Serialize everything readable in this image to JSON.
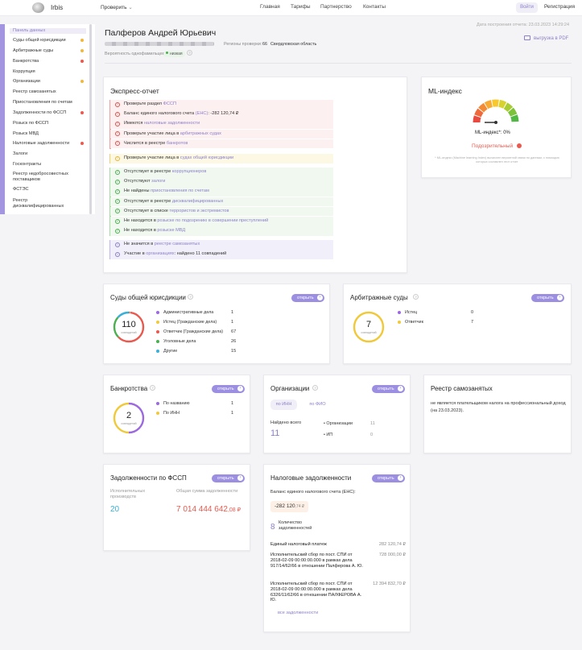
{
  "header": {
    "logo_text": "Irbis",
    "check_label": "Проверить",
    "nav": [
      "Главная",
      "Тарифы",
      "Партнерство",
      "Контакты"
    ],
    "login": "Войти",
    "register": "Регистрация"
  },
  "sidebar": {
    "items": [
      {
        "label": "Панель данных",
        "dot": ""
      },
      {
        "label": "Суды общей юрисдикции",
        "dot": "#f0b73a"
      },
      {
        "label": "Арбитражные суды",
        "dot": "#f0b73a"
      },
      {
        "label": "Банкротства",
        "dot": "#e85a4f"
      },
      {
        "label": "Коррупция",
        "dot": ""
      },
      {
        "label": "Организации",
        "dot": "#f0b73a"
      },
      {
        "label": "Реестр самозанятых",
        "dot": ""
      },
      {
        "label": "Приостановления по счетам",
        "dot": ""
      },
      {
        "label": "Задолженности по ФССП",
        "dot": "#e85a4f"
      },
      {
        "label": "Розыск по ФССП",
        "dot": ""
      },
      {
        "label": "Розыск МВД",
        "dot": ""
      },
      {
        "label": "Налоговые задолженности",
        "dot": "#e85a4f"
      },
      {
        "label": "Залоги",
        "dot": ""
      },
      {
        "label": "Госконтракты",
        "dot": ""
      },
      {
        "label": "Реестр недобросовестных поставщиков",
        "dot": ""
      },
      {
        "label": "ФСТЭС",
        "dot": ""
      },
      {
        "label": "Реестр дисквалифицированных",
        "dot": ""
      }
    ]
  },
  "person": {
    "name": "Палферов Андрей Юрьевич",
    "date": "Дата построения отчета: 23.03.2023 14:29:24",
    "pdf": "выгрузка в PDF",
    "regions_label": "Регионы проверки:",
    "region_code": "66",
    "region_name": "Свердловская область",
    "prob_label": "Вероятность однофамильцев:",
    "prob_value": "низкая"
  },
  "express": {
    "title": "Экспресс-отчет",
    "groups": [
      {
        "type": "red",
        "rows": [
          [
            "Проверьте раздел ",
            "ФССП",
            ""
          ],
          [
            "Баланс единого налогового счета ",
            "(ЕНС)",
            ": -282 120,74 ₽"
          ],
          [
            "Имеются ",
            "налоговые задолженности",
            ""
          ],
          [
            "Проверьте участие лица в ",
            "арбитражных судах",
            ""
          ],
          [
            "Числится в реестре ",
            "банкротов",
            ""
          ]
        ]
      },
      {
        "type": "yel",
        "rows": [
          [
            "Проверьте участие лица в ",
            "судах общей юрисдикции",
            ""
          ]
        ]
      },
      {
        "type": "grn",
        "rows": [
          [
            "Отсутствует в реестре ",
            "коррупционеров",
            ""
          ],
          [
            "Отсутствуют ",
            "залоги",
            ""
          ],
          [
            "Не найдены ",
            "приостановления по счетам",
            ""
          ],
          [
            "Отсутствует в реестре ",
            "дисквалифицированных",
            ""
          ],
          [
            "Отсутствует в списке ",
            "террористов и экстремистов",
            ""
          ],
          [
            "Не находится в ",
            "розыске по подозрению в совершении преступлений",
            ""
          ],
          [
            "Не находится в ",
            "розыске МВД",
            ""
          ]
        ]
      },
      {
        "type": "pur",
        "rows": [
          [
            "Не значится в ",
            "реестре самозанятых",
            ""
          ],
          [
            "Участие в ",
            "организациях",
            ": найдено 11 совпадений"
          ]
        ]
      }
    ]
  },
  "ml": {
    "title": "ML-индекс",
    "value_label": "ML-индекс*: 0%",
    "status": "Подозрительный",
    "note": "* ML-индекс (Machine learning Index) вычислен вероятной связи по данным, с помощью которых составлен этот отчет"
  },
  "courts": {
    "title": "Суды общей юрисдикции",
    "open": "открыть",
    "total": "110",
    "sub": "совпадений",
    "legend": [
      [
        "Административные дела",
        "1",
        "#9c6ade"
      ],
      [
        "Истец (Гражданские дела)",
        "1",
        "#f0c93a"
      ],
      [
        "Ответчик (Гражданские дела)",
        "67",
        "#e85a4f"
      ],
      [
        "Уголовные дела",
        "26",
        "#4caf50"
      ],
      [
        "Другие",
        "15",
        "#3ab0d6"
      ]
    ]
  },
  "arb": {
    "title": "Арбитражные суды",
    "open": "открыть",
    "total": "7",
    "sub": "совпадений",
    "legend": [
      [
        "Истец",
        "0",
        "#9c6ade"
      ],
      [
        "Ответчик",
        "7",
        "#f0c93a"
      ]
    ]
  },
  "bank": {
    "title": "Банкротства",
    "open": "открыть",
    "total": "2",
    "sub": "совпадений",
    "legend": [
      [
        "По названию",
        "1",
        "#9c6ade"
      ],
      [
        "По ИНН",
        "1",
        "#f0c93a"
      ]
    ]
  },
  "orgs": {
    "title": "Организации",
    "open": "открыть",
    "tab1": "по ИНН",
    "tab2": "по ФИО",
    "found_label": "Найдено всего",
    "found": "11",
    "items": [
      [
        "Организации",
        "11"
      ],
      [
        "ИП",
        "0"
      ]
    ]
  },
  "selfemp": {
    "title": "Реестр самозанятых",
    "text": "не является плательщиком налога на профессиональный доход (на 23.03.2023)."
  },
  "fssp": {
    "title": "Задолженности по ФССП",
    "open": "открыть",
    "l1": "Исполнительных производств",
    "v1": "20",
    "l2": "Общая сумма задолженности",
    "v2": "7 014 444 642",
    "v2c": ",08 ₽"
  },
  "tax": {
    "title": "Налоговые задолженности",
    "open": "открыть",
    "bal_label": "Баланс единого налогового счета (ЕНС):",
    "bal": "-282 120",
    "bal_c": ",74 ₽",
    "count": "8",
    "count_label": "Количество задолженностей",
    "rows": [
      [
        "Единый налоговый платеж",
        "282 120,74 ₽"
      ],
      [
        "Исполнительский сбор по пост. СПИ от 2018-02-09 00:00:00.000 в рамках дела 917/14/62/66 в отношении Палферова А. Ю.",
        "728 000,00 ₽"
      ],
      [
        "Исполнительский сбор по пост. СПИ от 2018-02-09 00:00:00.000 в рамках дела 6326/11/62/66 в отношении ПАЛФЕРОВА А. Ю.",
        "12 394 832,70 ₽"
      ]
    ],
    "all": "все задолженности"
  },
  "colors": {
    "accent": "#9c8ee0",
    "danger": "#e85a4f",
    "warn": "#f0b73a",
    "ok": "#4caf50",
    "info": "#3ab0d6"
  }
}
